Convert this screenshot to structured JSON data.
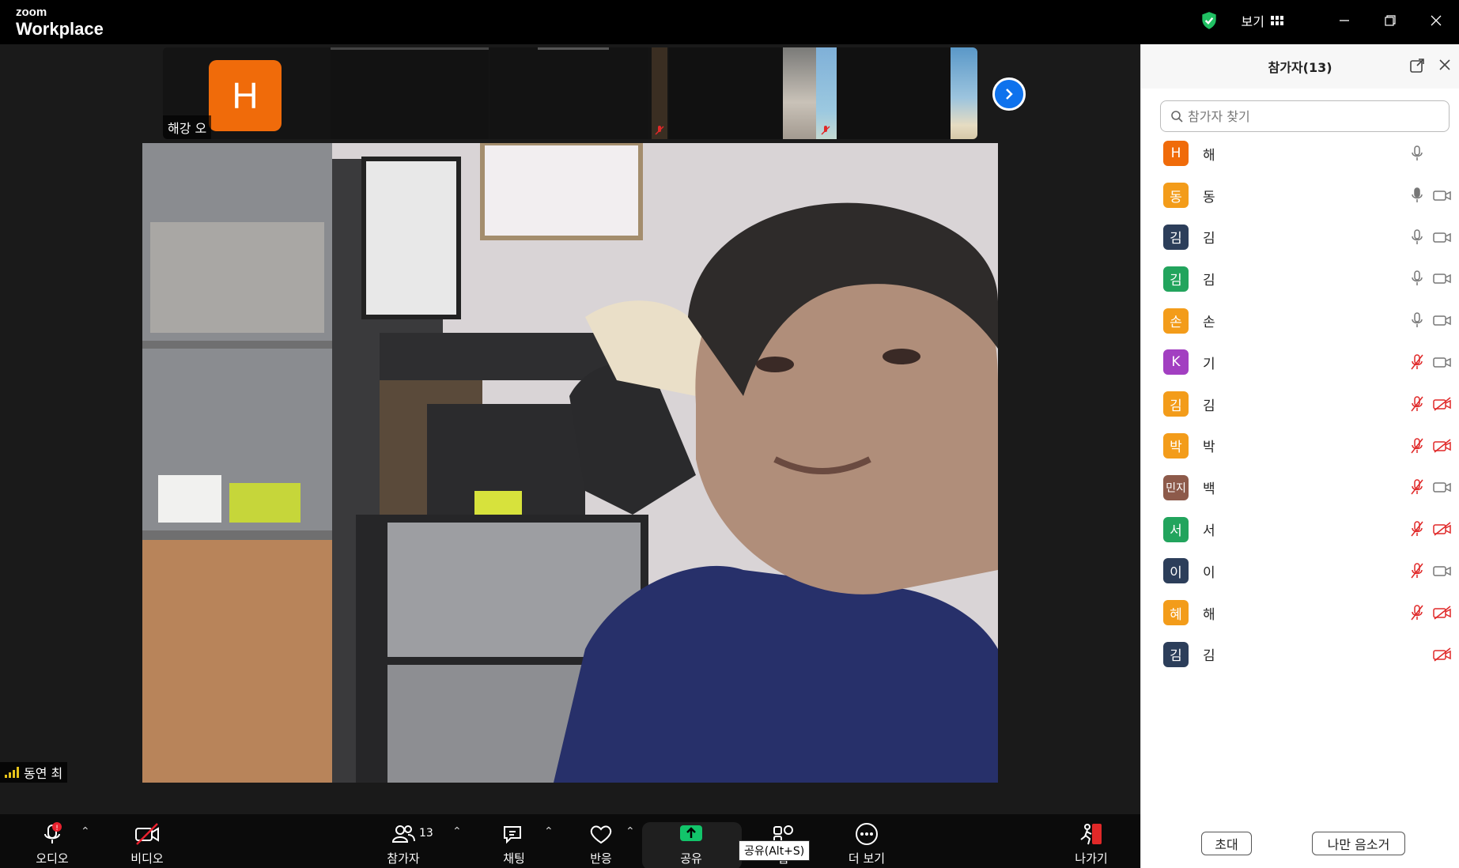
{
  "app": {
    "brand_small": "zoom",
    "brand_large": "Workplace"
  },
  "titlebar": {
    "view_label": "보기",
    "shield_icon": "shield-check-icon",
    "accent": "#20c063"
  },
  "filmstrip": {
    "tiles": [
      {
        "initial": "H",
        "name": "해강 오",
        "color": "#f06b0a"
      }
    ]
  },
  "main_video": {
    "speaker_name": "동연 최"
  },
  "toolbar": {
    "audio_label": "오디오",
    "audio_badge": "!",
    "video_label": "비디오",
    "participants_label": "참가자",
    "participants_count": "13",
    "chat_label": "채팅",
    "reactions_label": "반응",
    "share_label": "공유",
    "share_tooltip": "공유(Alt+S)",
    "apps_label": "앱",
    "more_label": "더 보기",
    "leave_label": "나가기",
    "share_color": "#12c46a",
    "leave_color": "#e02828"
  },
  "panel": {
    "title": "참가자(13)",
    "search_placeholder": "참가자 찾기",
    "participants": [
      {
        "initial": "H",
        "name": "해",
        "color": "#f06b0a",
        "mic": "on",
        "cam": "none"
      },
      {
        "initial": "동",
        "name": "동",
        "color": "#f39c1a",
        "mic": "active",
        "cam": "on"
      },
      {
        "initial": "김",
        "name": "김",
        "color": "#2c3e5a",
        "mic": "on",
        "cam": "on"
      },
      {
        "initial": "김",
        "name": "김",
        "color": "#22a45d",
        "mic": "on",
        "cam": "on"
      },
      {
        "initial": "손",
        "name": "손",
        "color": "#f39c1a",
        "mic": "on",
        "cam": "on"
      },
      {
        "initial": "K",
        "name": "기",
        "color": "#a23fc1",
        "mic": "muted",
        "cam": "on"
      },
      {
        "initial": "김",
        "name": "김",
        "color": "#f39c1a",
        "mic": "muted",
        "cam": "off"
      },
      {
        "initial": "박",
        "name": "박",
        "color": "#f39c1a",
        "mic": "muted",
        "cam": "off"
      },
      {
        "initial": "민지",
        "name": "백",
        "color": "#8d5a4a",
        "mic": "muted",
        "cam": "on"
      },
      {
        "initial": "서",
        "name": "서",
        "color": "#22a45d",
        "mic": "muted",
        "cam": "off"
      },
      {
        "initial": "이",
        "name": "이",
        "color": "#2c3e5a",
        "mic": "muted",
        "cam": "on"
      },
      {
        "initial": "혜",
        "name": "해",
        "color": "#f39c1a",
        "mic": "muted",
        "cam": "off"
      },
      {
        "initial": "김",
        "name": "김",
        "color": "#2c3e5a",
        "mic": "none",
        "cam": "off"
      }
    ],
    "invite_label": "초대",
    "mute_me_label": "나만 음소거"
  }
}
